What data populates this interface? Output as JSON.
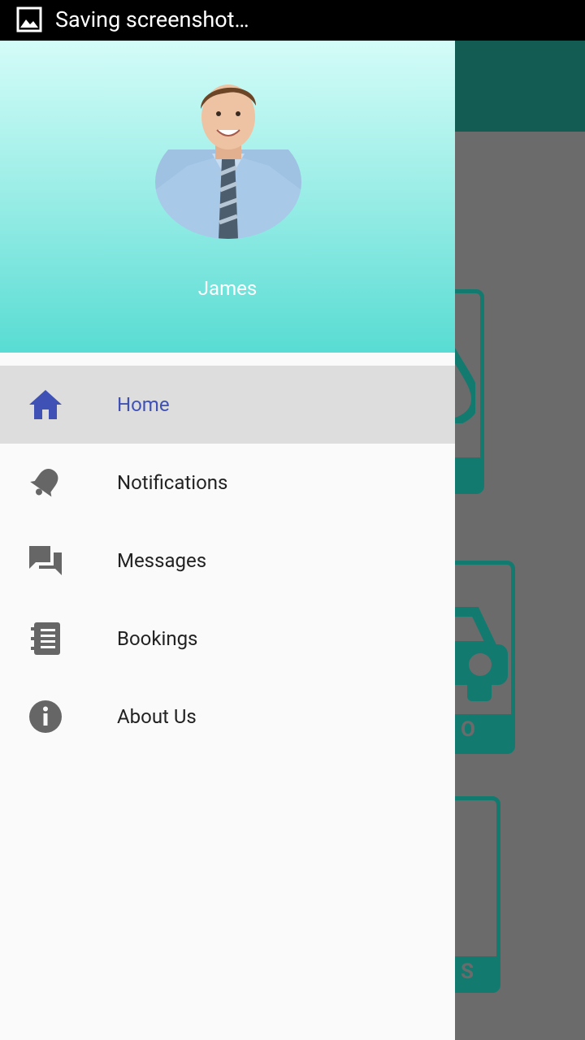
{
  "status_bar": {
    "text": "Saving screenshot…",
    "icon": "image-icon"
  },
  "drawer": {
    "user_name": "James",
    "header_gradient": [
      "#d4fcf8",
      "#58dcd3"
    ],
    "items": [
      {
        "label": "Home",
        "icon": "home-icon",
        "active": true
      },
      {
        "label": "Notifications",
        "icon": "bell-icon",
        "active": false
      },
      {
        "label": "Messages",
        "icon": "chat-icon",
        "active": false
      },
      {
        "label": "Bookings",
        "icon": "notebook-icon",
        "active": false
      },
      {
        "label": "About Us",
        "icon": "info-icon",
        "active": false
      }
    ]
  },
  "background_app": {
    "toolbar_color": "#135c54",
    "card_color": "#137a70",
    "visible_fragments": [
      "O",
      "S"
    ]
  },
  "colors": {
    "accent": "#3f51b5",
    "icon_gray": "#666666"
  }
}
